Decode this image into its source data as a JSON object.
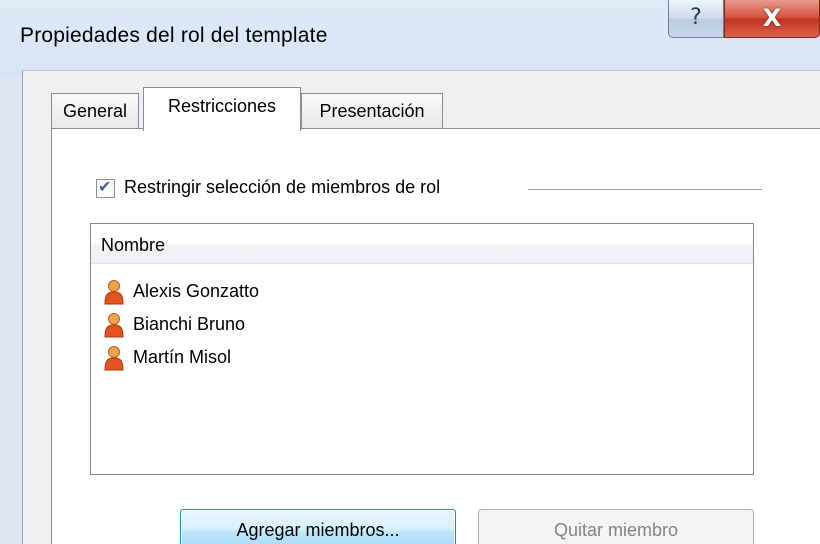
{
  "window": {
    "title": "Propiedades del rol del template",
    "help_glyph": "?",
    "close_glyph": "X"
  },
  "tabs": [
    {
      "label": "General",
      "selected": false
    },
    {
      "label": "Restricciones",
      "selected": true
    },
    {
      "label": "Presentación",
      "selected": false
    }
  ],
  "restrictions": {
    "checkbox_label": "Restringir selección de miembros de rol",
    "checked": true,
    "check_glyph": "✔",
    "column_header": "Nombre",
    "members": [
      {
        "name": "Alexis Gonzatto",
        "icon": "user-icon"
      },
      {
        "name": "Bianchi Bruno",
        "icon": "user-icon"
      },
      {
        "name": "Martín Misol",
        "icon": "user-icon"
      }
    ]
  },
  "buttons": {
    "add_label": "Agregar miembros...",
    "remove_label": "Quitar miembro",
    "remove_enabled": false
  },
  "colors": {
    "close_button": "#c2351f",
    "focus_button_border": "#3c7fb1",
    "user_icon_body": "#e3531b",
    "user_icon_head": "#f4a24a"
  }
}
